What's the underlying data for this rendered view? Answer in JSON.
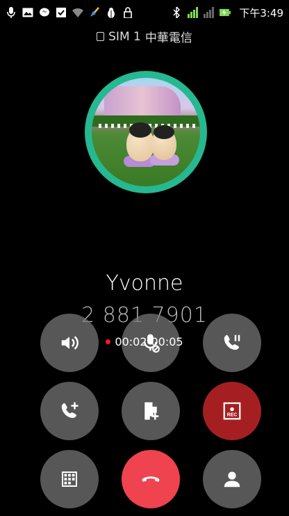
{
  "status_bar": {
    "time": "下午3:49",
    "icons": [
      "mic-icon",
      "image-icon",
      "messenger-icon",
      "checkbox-icon",
      "wifi-icon",
      "cleaner-icon",
      "bug-icon",
      "lock-icon",
      "bluetooth-icon",
      "signal-icon",
      "signal-no-service-icon",
      "battery-charging-icon"
    ]
  },
  "call": {
    "sim_label": "SIM 1",
    "carrier": "中華電信",
    "contact_name": "Yvonne",
    "phone_number": "2 881 7901",
    "record_time": "00:02",
    "call_duration": "00:05"
  },
  "controls": {
    "speaker": "speaker-icon",
    "mute": "mute-mic-icon",
    "hold": "hold-call-icon",
    "add_call": "add-call-icon",
    "note": "add-note-icon",
    "record": "REC",
    "keypad": "dialpad-icon",
    "end_call": "end-call-icon",
    "contacts": "contact-icon"
  },
  "colors": {
    "ring": "#26b890",
    "record_button": "#a51f22",
    "end_call_button": "#ef4350",
    "recording_dot": "#ff1a1a"
  }
}
